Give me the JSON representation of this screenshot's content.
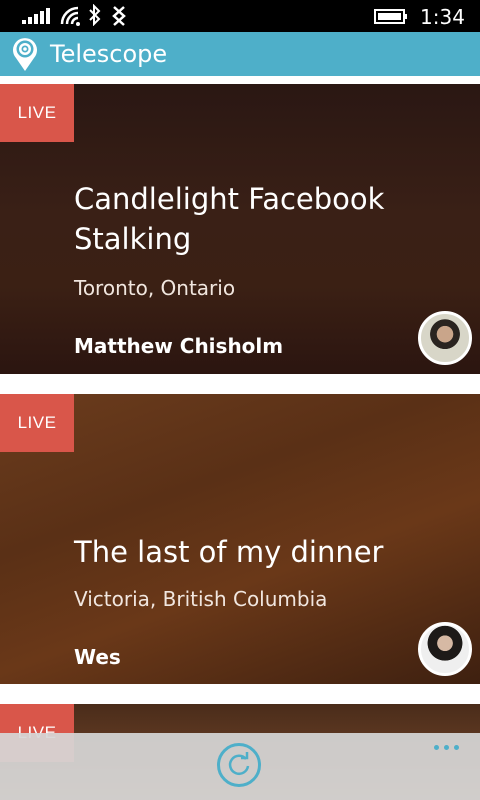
{
  "status_bar": {
    "time": "1:34",
    "icons": [
      "signal-icon",
      "wifi-icon",
      "bluetooth-icon",
      "data-icon",
      "battery-icon"
    ]
  },
  "header": {
    "title": "Telescope",
    "logo_icon": "location-pin-icon",
    "color": "#4eafc9"
  },
  "feed": [
    {
      "badge": "LIVE",
      "title": "Candlelight Facebook Stalking",
      "location": "Toronto, Ontario",
      "author": "Matthew Chisholm"
    },
    {
      "badge": "LIVE",
      "title": "The last of my dinner",
      "location": "Victoria, British Columbia",
      "author": "Wes"
    },
    {
      "badge": "LIVE"
    }
  ],
  "app_bar": {
    "refresh_icon": "refresh-icon",
    "more_icon": "more-dots-icon"
  },
  "colors": {
    "accent": "#4eafc9",
    "live": "#d9564a"
  }
}
